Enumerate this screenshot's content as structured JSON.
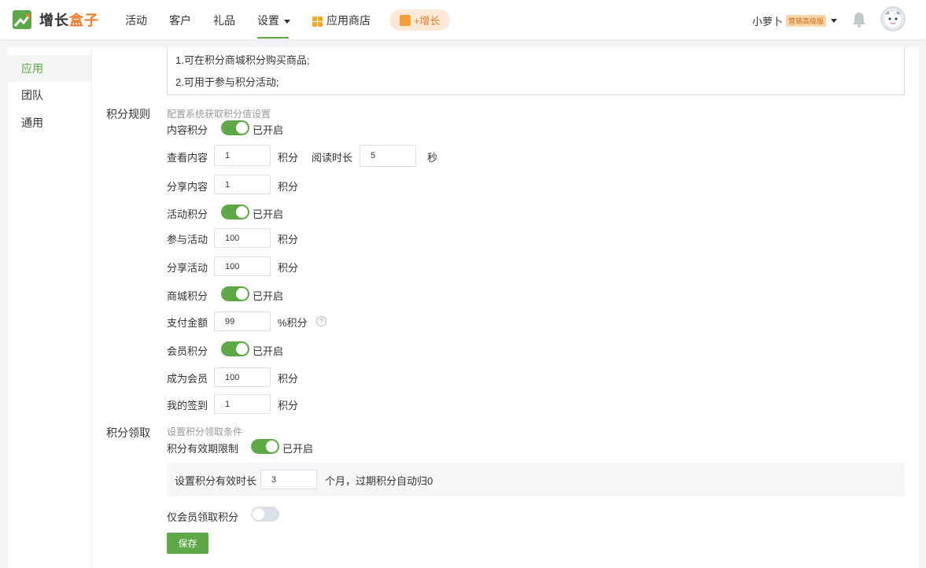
{
  "header": {
    "brand_main": "增长",
    "brand_accent": "盒子",
    "nav": [
      "活动",
      "客户",
      "礼品",
      "设置",
      "应用商店"
    ],
    "growth_button": "+增长",
    "user_name": "小萝卜",
    "user_badge": "营销高级版"
  },
  "sidebar": {
    "items": [
      "应用",
      "团队",
      "通用"
    ]
  },
  "description": {
    "line1": "1.可在积分商城积分购买商品;",
    "line2": "2.可用于参与积分活动;"
  },
  "rules": {
    "section_label": "积分规则",
    "hint": "配置系统获取积分值设置",
    "content_points": {
      "label": "内容积分",
      "status": "已开启",
      "enabled": true
    },
    "view_content": {
      "label": "查看内容",
      "value": "1",
      "unit": "积分",
      "read_label": "阅读时长",
      "read_value": "5",
      "read_unit": "秒"
    },
    "share_content": {
      "label": "分享内容",
      "value": "1",
      "unit": "积分"
    },
    "activity_points": {
      "label": "活动积分",
      "status": "已开启",
      "enabled": true
    },
    "join_activity": {
      "label": "参与活动",
      "value": "100",
      "unit": "积分"
    },
    "share_activity": {
      "label": "分享活动",
      "value": "100",
      "unit": "积分"
    },
    "mall_points": {
      "label": "商城积分",
      "status": "已开启",
      "enabled": true
    },
    "pay_amount": {
      "label": "支付金额",
      "value": "99",
      "unit": "%积分",
      "help": "?"
    },
    "member_points": {
      "label": "会员积分",
      "status": "已开启",
      "enabled": true
    },
    "become_member": {
      "label": "成为会员",
      "value": "100",
      "unit": "积分"
    },
    "my_checkin": {
      "label": "我的签到",
      "value": "1",
      "unit": "积分"
    }
  },
  "claim": {
    "section_label": "积分领取",
    "hint": "设置积分领取条件",
    "validity_limit": {
      "label": "积分有效期限制",
      "status": "已开启",
      "enabled": true
    },
    "validity_duration": {
      "label": "设置积分有效时长",
      "value": "3",
      "unit": "个月，过期积分自动归0"
    },
    "members_only": {
      "label": "仅会员领取积分",
      "enabled": false
    },
    "save_label": "保存"
  },
  "colors": {
    "primary_green": "#5fa848",
    "accent_orange": "#f07c2a"
  }
}
